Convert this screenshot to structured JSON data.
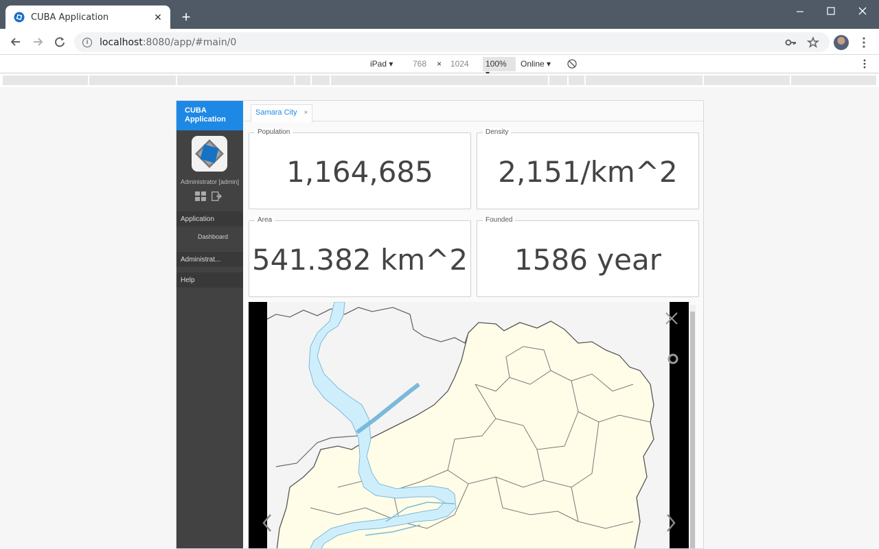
{
  "browser": {
    "tab_title": "CUBA Application",
    "new_tab_label": "+",
    "url_host": "localhost",
    "url_rest": ":8080/app/#main/0"
  },
  "devtools": {
    "device": "iPad",
    "width": "768",
    "times": "×",
    "height": "1024",
    "zoom": "100%",
    "network": "Online"
  },
  "sidebar": {
    "brand_line1": "CUBA",
    "brand_line2": "Application",
    "user": "Administrator [admin]",
    "menu": [
      {
        "label": "Application"
      },
      {
        "label": "Dashboard"
      },
      {
        "label": "Administrat..."
      },
      {
        "label": "Help"
      }
    ]
  },
  "main": {
    "tab_label": "Samara City",
    "tab_close": "×",
    "cards": [
      {
        "caption": "Population",
        "value": "1,164,685"
      },
      {
        "caption": "Density",
        "value": "2,151/km^2"
      },
      {
        "caption": "Area",
        "value": "541.382 km^2"
      },
      {
        "caption": "Founded",
        "value": "1586 year"
      }
    ]
  },
  "colors": {
    "accent": "#1e88e5",
    "sidebar": "#424242",
    "map_land": "#fffde8",
    "map_water": "#cfeefc"
  }
}
